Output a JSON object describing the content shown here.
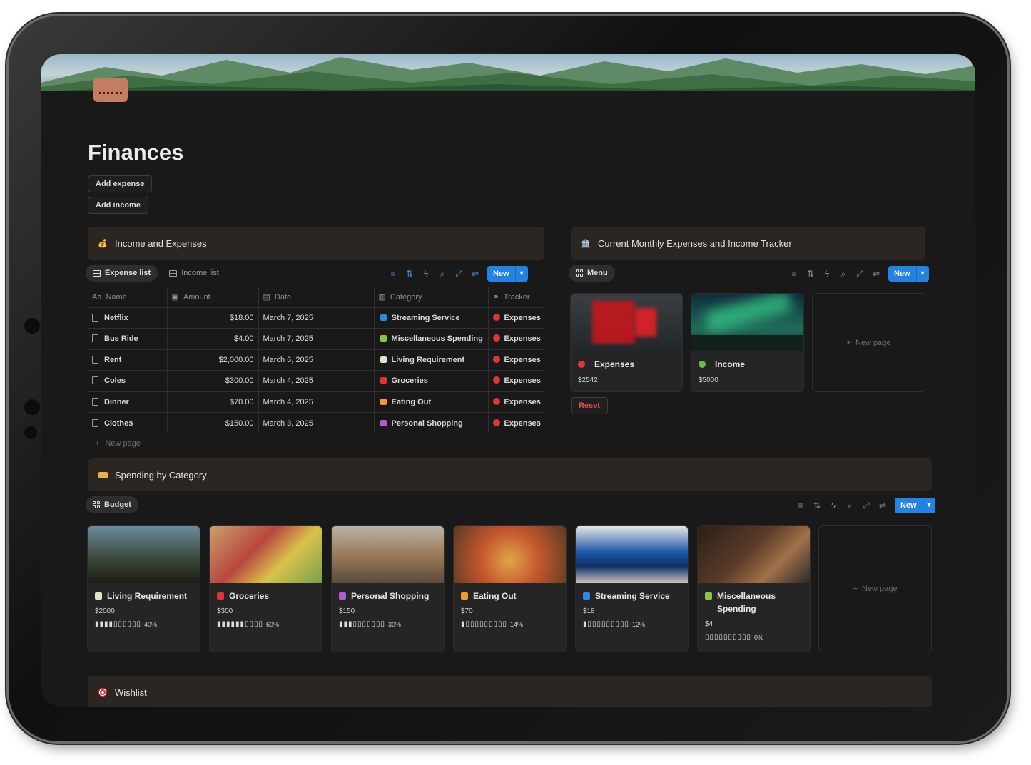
{
  "page": {
    "title": "Finances",
    "buttons": {
      "add_expense": "Add expense",
      "add_income": "Add income"
    }
  },
  "income_expenses": {
    "heading": "Income and Expenses",
    "tabs": [
      {
        "label": "Expense list",
        "active": true
      },
      {
        "label": "Income list",
        "active": false
      }
    ],
    "new_label": "New",
    "columns": [
      "Name",
      "Amount",
      "Date",
      "Category",
      "Tracker"
    ],
    "column_prefix": "Aa",
    "rows": [
      {
        "name": "Netflix",
        "amount": "$18.00",
        "date": "March 7, 2025",
        "category": "Streaming Service",
        "category_color": "#2e88e8",
        "tracker": "Expenses"
      },
      {
        "name": "Bus Ride",
        "amount": "$4.00",
        "date": "March 7, 2025",
        "category": "Miscellaneous Spending",
        "category_color": "#8ac44a",
        "tracker": "Expenses"
      },
      {
        "name": "Rent",
        "amount": "$2,000.00",
        "date": "March 6, 2025",
        "category": "Living Requirement",
        "category_color": "#e8e0c8",
        "tracker": "Expenses"
      },
      {
        "name": "Coles",
        "amount": "$300.00",
        "date": "March 4, 2025",
        "category": "Groceries",
        "category_color": "#e0343b",
        "tracker": "Expenses"
      },
      {
        "name": "Dinner",
        "amount": "$70.00",
        "date": "March 4, 2025",
        "category": "Eating Out",
        "category_color": "#f39a2b",
        "tracker": "Expenses"
      },
      {
        "name": "Clothes",
        "amount": "$150.00",
        "date": "March 3, 2025",
        "category": "Personal Shopping",
        "category_color": "#b35ad0",
        "tracker": "Expenses"
      }
    ],
    "tracker_color": "#e0343b",
    "new_page": "New page"
  },
  "tracker": {
    "heading": "Current Monthly Expenses and Income Tracker",
    "tab": "Menu",
    "new_label": "New",
    "cards": [
      {
        "name": "Expenses",
        "value": "$2542",
        "dot_color": "#e0343b"
      },
      {
        "name": "Income",
        "value": "$5000",
        "dot_color": "#5fbf4a"
      }
    ],
    "new_page": "New page",
    "reset": "Reset"
  },
  "spending": {
    "heading": "Spending by Category",
    "tab": "Budget",
    "new_label": "New",
    "cards": [
      {
        "name": "Living Requirement",
        "value": "$2000",
        "bar": "▮▮▮▮▯▯▯▯▯▯",
        "percent": "40%",
        "icon_color": "#e8e0c8"
      },
      {
        "name": "Groceries",
        "value": "$300",
        "bar": "▮▮▮▮▮▮▯▯▯▯",
        "percent": "60%",
        "icon_color": "#e0343b"
      },
      {
        "name": "Personal Shopping",
        "value": "$150",
        "bar": "▮▮▮▯▯▯▯▯▯▯",
        "percent": "30%",
        "icon_color": "#b35ad0"
      },
      {
        "name": "Eating Out",
        "value": "$70",
        "bar": "▮▯▯▯▯▯▯▯▯▯",
        "percent": "14%",
        "icon_color": "#f39a2b"
      },
      {
        "name": "Streaming Service",
        "value": "$18",
        "bar": "▮▯▯▯▯▯▯▯▯▯",
        "percent": "12%",
        "icon_color": "#2e88e8"
      },
      {
        "name": "Miscellaneous Spending",
        "value": "$4",
        "bar": "▯▯▯▯▯▯▯▯▯▯",
        "percent": "0%",
        "icon_color": "#8ac44a"
      }
    ],
    "new_page": "New page"
  },
  "wishlist": {
    "heading": "Wishlist"
  }
}
